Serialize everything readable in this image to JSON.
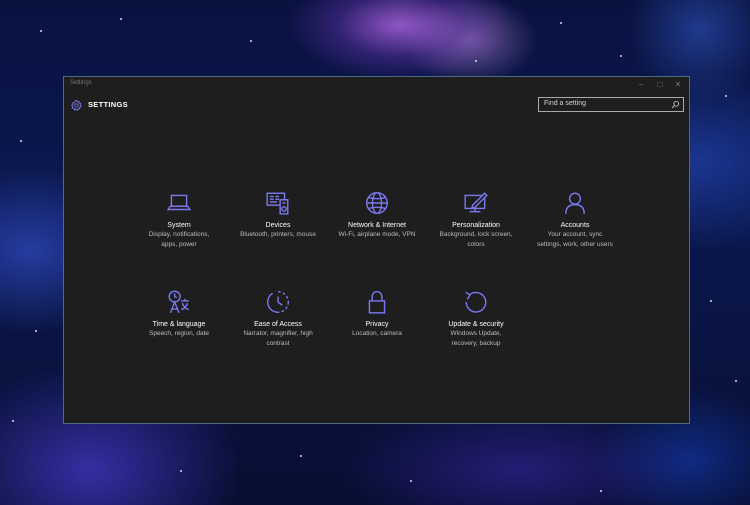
{
  "window": {
    "title": "Settings"
  },
  "header": {
    "title": "SETTINGS"
  },
  "search": {
    "placeholder": "Find a setting"
  },
  "colors": {
    "accent": "#7b78f0",
    "window_bg": "#1e1e1e"
  },
  "tiles": [
    {
      "label": "System",
      "description": "Display, notifications, apps, power",
      "icon": "system-icon"
    },
    {
      "label": "Devices",
      "description": "Bluetooth, printers, mouse",
      "icon": "devices-icon"
    },
    {
      "label": "Network & Internet",
      "description": "Wi-Fi, airplane mode, VPN",
      "icon": "network-icon"
    },
    {
      "label": "Personalization",
      "description": "Background, lock screen, colors",
      "icon": "personalization-icon"
    },
    {
      "label": "Accounts",
      "description": "Your account, sync settings, work, other users",
      "icon": "accounts-icon"
    },
    {
      "label": "Time & language",
      "description": "Speech, region, date",
      "icon": "time-language-icon"
    },
    {
      "label": "Ease of Access",
      "description": "Narrator, magnifier, high contrast",
      "icon": "ease-of-access-icon"
    },
    {
      "label": "Privacy",
      "description": "Location, camera",
      "icon": "privacy-icon"
    },
    {
      "label": "Update & security",
      "description": "Windows Update, recovery, backup",
      "icon": "update-security-icon"
    }
  ]
}
